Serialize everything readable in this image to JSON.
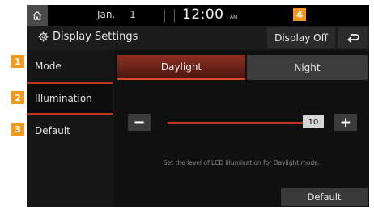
{
  "status_bar": {
    "date": "Jan. 1",
    "time": "12:00",
    "ampm": "AM"
  },
  "header": {
    "title": "Display Settings",
    "display_off_label": "Display Off"
  },
  "sidebar": {
    "items": [
      {
        "label": "Mode"
      },
      {
        "label": "Illumination",
        "selected": true
      },
      {
        "label": "Default"
      }
    ]
  },
  "tabs": [
    {
      "label": "Daylight",
      "selected": true
    },
    {
      "label": "Night",
      "selected": false
    }
  ],
  "illumination": {
    "value": "10",
    "min": 0,
    "max": 10,
    "hint": "Set the level of LCD illumination for Daylight mode."
  },
  "default_button_label": "Default",
  "callouts": [
    "1",
    "2",
    "3",
    "4"
  ],
  "colors": {
    "accent": "#c0341d",
    "badge": "#f39a1e",
    "background": "#141414"
  },
  "icons": [
    "home-icon",
    "gear-icon",
    "back-icon"
  ]
}
